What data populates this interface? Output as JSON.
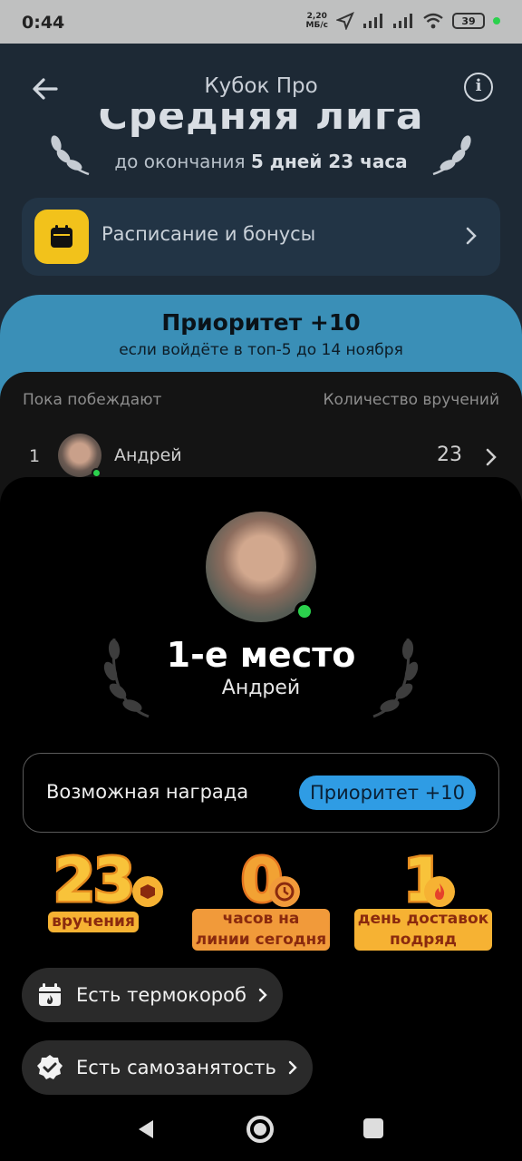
{
  "status_bar": {
    "time": "0:44",
    "speed_value": "2,20",
    "speed_unit": "МБ/с",
    "battery": "39"
  },
  "header": {
    "title": "Кубок Про"
  },
  "league": {
    "title": "Средняя лига",
    "deadline_prefix": "до окончания ",
    "deadline_value": "5 дней 23 часа"
  },
  "schedule": {
    "label": "Расписание и бонусы"
  },
  "priority": {
    "title": "Приоритет +10",
    "subtitle": "если войдёте в топ-5 до 14 ноября"
  },
  "leaderboard": {
    "col_left": "Пока побеждают",
    "col_right": "Количество вручений",
    "rows": [
      {
        "rank": "1",
        "name": "Андрей",
        "count": "23"
      }
    ]
  },
  "profile": {
    "place": "1-е место",
    "name": "Андрей",
    "reward_label": "Возможная награда",
    "reward_value": "Приоритет +10"
  },
  "stats": [
    {
      "value": "23",
      "caption": "вручения"
    },
    {
      "value": "0",
      "caption_line1": "часов на",
      "caption_line2": "линии сегодня"
    },
    {
      "value": "1",
      "caption_line1": "день доставок",
      "caption_line2": "подряд"
    }
  ],
  "features": [
    {
      "label": "Есть термокороб"
    },
    {
      "label": "Есть самозанятость"
    }
  ],
  "colors": {
    "accent_blue": "#3a8fb7",
    "chip_blue": "#2f9ce4",
    "online_green": "#2bd14d",
    "badge_yellow": "#f8c33a",
    "badge_orange": "#f2a233"
  }
}
